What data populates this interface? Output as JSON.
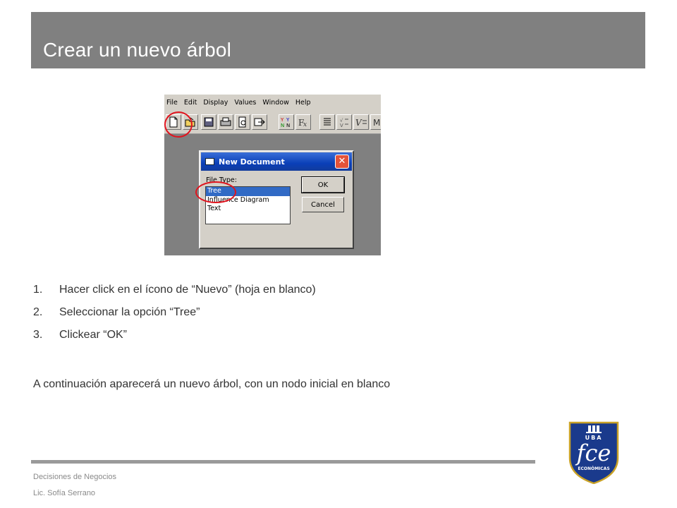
{
  "slide": {
    "title": "Crear un nuevo árbol",
    "colors": {
      "title_band": "#808080",
      "title_text": "#ffffff",
      "body_text": "#333333",
      "highlight_circle": "#e0141e",
      "logo_blue": "#1a3a8c"
    }
  },
  "screenshot": {
    "menu": [
      "File",
      "Edit",
      "Display",
      "Values",
      "Window",
      "Help"
    ],
    "toolbar_icons": [
      "new-document-icon",
      "open-folder-icon",
      "save-icon",
      "print-icon",
      "print-preview-icon",
      "export-icon",
      "yn-node-icon",
      "formula-icon",
      "list-icon",
      "values-icon",
      "v-equals-icon",
      "m-icon"
    ],
    "dialog": {
      "title": "New Document",
      "close_glyph": "✕",
      "file_type_label": "File Type:",
      "options": [
        "Tree",
        "Influence Diagram",
        "Text"
      ],
      "selected_option": "Tree",
      "ok_label": "OK",
      "cancel_label": "Cancel"
    }
  },
  "steps": [
    {
      "number": "1.",
      "text": "Hacer click en el ícono de “Nuevo” (hoja en blanco)"
    },
    {
      "number": "2.",
      "text": "Seleccionar la opción “Tree”"
    },
    {
      "number": "3.",
      "text": "Clickear “OK”"
    }
  ],
  "note": "A continuación aparecerá un nuevo árbol, con un nodo inicial en blanco",
  "footer": {
    "course": "Decisiones de Negocios",
    "author": "Lic. Sofía Serrano"
  },
  "logo": {
    "top_text": "UBA",
    "main_text": "fce",
    "bottom_text": "ECONÓMICAS"
  }
}
